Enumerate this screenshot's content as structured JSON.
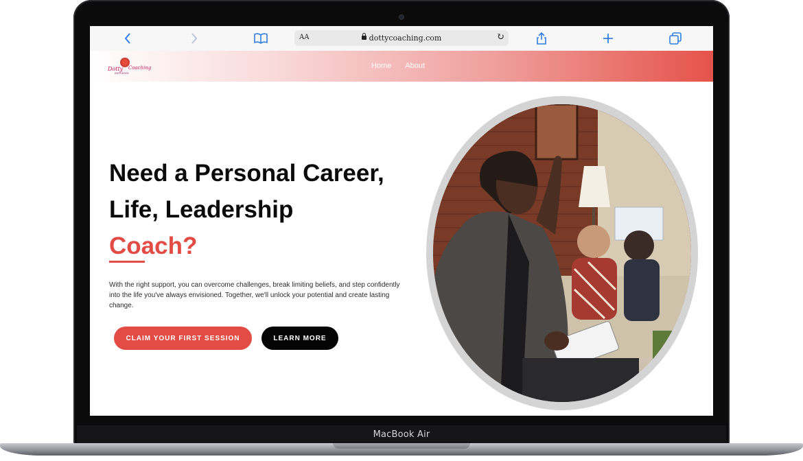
{
  "device": {
    "label": "MacBook Air"
  },
  "browser": {
    "reader_label": "AA",
    "url": "dottycoaching.com",
    "icons": [
      "back-icon",
      "forward-icon",
      "bookmarks-icon",
      "lock-icon",
      "reload-icon",
      "share-icon",
      "new-tab-icon",
      "tabs-icon"
    ]
  },
  "site": {
    "logo": {
      "line1": "Dotty",
      "line2": "Coaching",
      "line3": "services"
    },
    "nav": [
      {
        "label": "Home"
      },
      {
        "label": "About"
      }
    ]
  },
  "hero": {
    "title_line1": "Need a Personal Career,",
    "title_line2": "Life, Leadership",
    "title_accent": "Coach?",
    "copy": "With the right support, you can overcome challenges, break limiting beliefs, and step confidently into the life you've always envisioned. Together, we'll unlock your potential and create lasting change.",
    "primary_button": "CLAIM YOUR FIRST SESSION",
    "secondary_button": "LEARN MORE"
  },
  "colors": {
    "accent": "#e24c44",
    "dark": "#050505",
    "link": "#2f7de1"
  }
}
